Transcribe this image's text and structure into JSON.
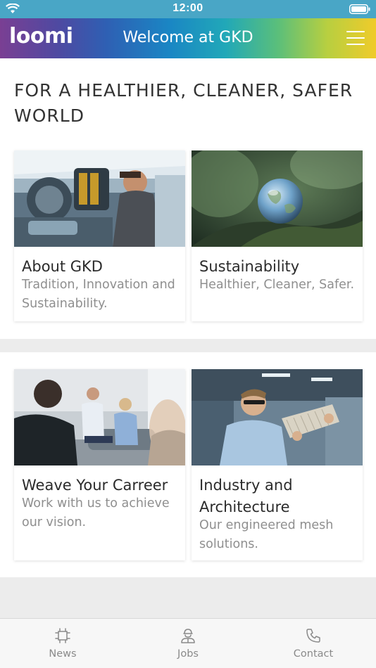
{
  "status_bar": {
    "time": "12:00"
  },
  "header": {
    "logo_text": "loomi",
    "title": "Welcome at GKD"
  },
  "headline": "FOR A HEALTHIER, CLEANER, SAFER WORLD",
  "cards": [
    {
      "title": "About GKD",
      "subtitle": "Tradition, Innovation and Sustainability."
    },
    {
      "title": "Sustainability",
      "subtitle": "Healthier, Cleaner, Safer."
    },
    {
      "title": "Weave Your Carreer",
      "subtitle": "Work with us to achieve our vision."
    },
    {
      "title": "Industry and Architecture",
      "subtitle": "Our engineered mesh solutions."
    }
  ],
  "tabs": [
    {
      "label": "News",
      "icon": "news-icon"
    },
    {
      "label": "Jobs",
      "icon": "jobs-icon"
    },
    {
      "label": "Contact",
      "icon": "phone-icon"
    }
  ],
  "colors": {
    "status_bar": "#49a6c6",
    "text_dark": "#333333",
    "text_muted": "#8f8f8f",
    "background": "#ececec"
  }
}
